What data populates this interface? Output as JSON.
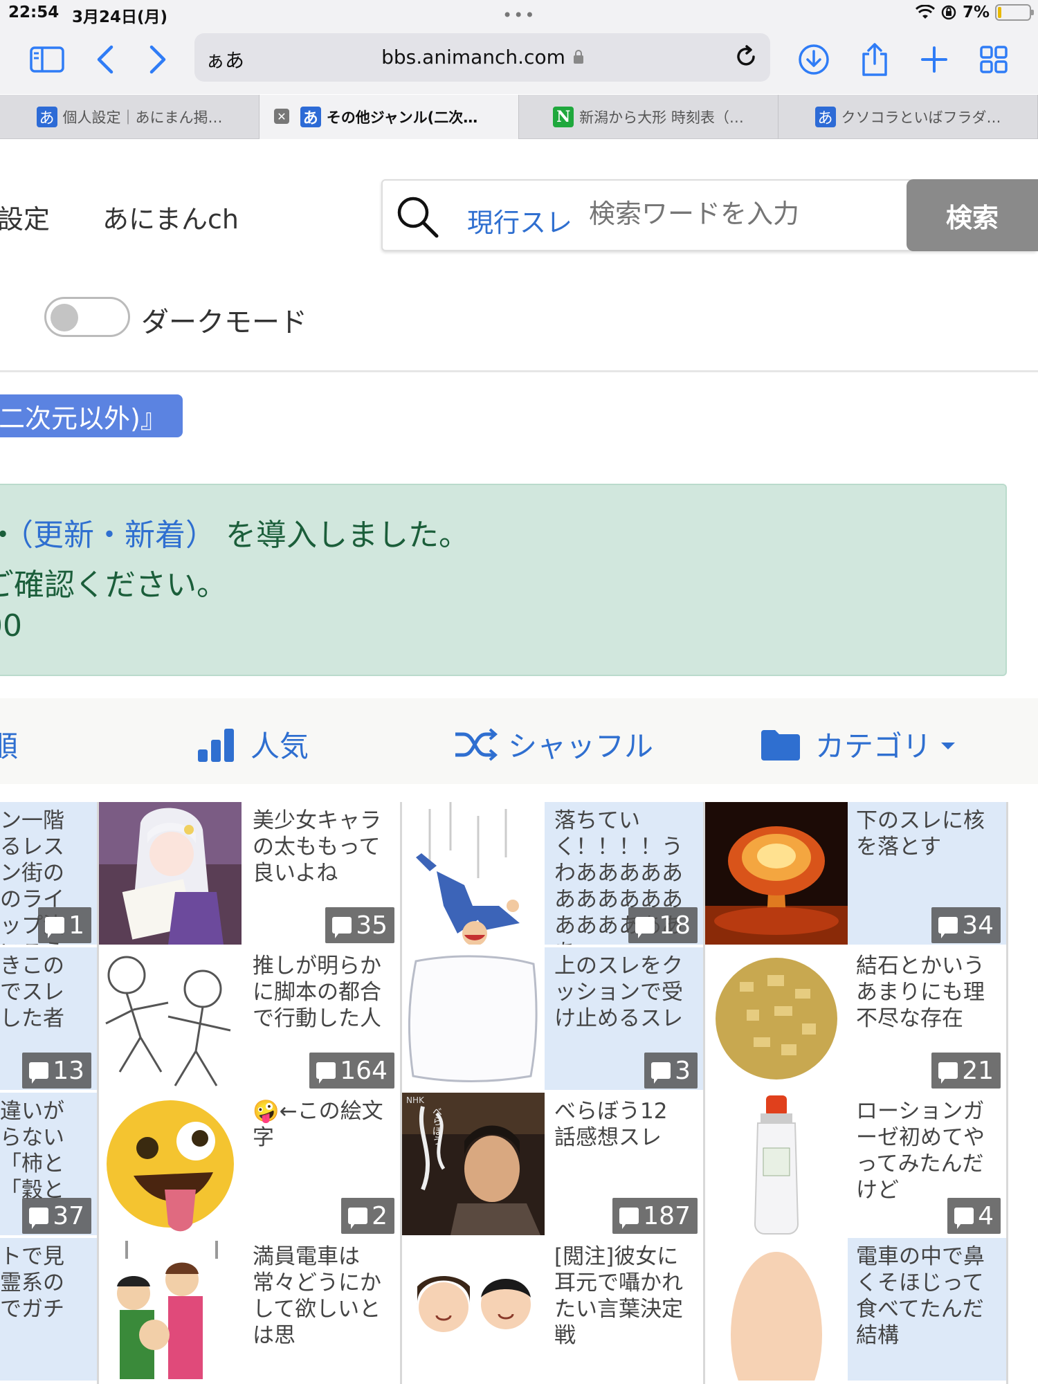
{
  "status": {
    "time": "22:54",
    "date": "3月24日(月)",
    "battery": "7%"
  },
  "browser": {
    "url_aa": "ぁあ",
    "url": "bbs.animanch.com",
    "tabs": [
      {
        "favicon": "あ",
        "title": "個人設定｜あにまん掲…"
      },
      {
        "favicon": "あ",
        "title": "その他ジャンル(二次…"
      },
      {
        "favicon": "N",
        "title": "新潟から大形 時刻表（…"
      },
      {
        "favicon": "あ",
        "title": "クソコラといばフラダ…"
      }
    ]
  },
  "header": {
    "settings_link": "設定",
    "site_link": "あにまんch",
    "search_scope": "現行スレ",
    "search_placeholder": "検索ワードを入力",
    "search_button": "検索",
    "dark_mode_label": "ダークモード"
  },
  "board": {
    "badge": "二次元以外)』"
  },
  "notice": {
    "line1_link": "（更新・新着）",
    "line1_text": "を導入しました。",
    "line1_prefix": "・",
    "line2": "ご確認ください。",
    "line3": "00"
  },
  "sort": {
    "partial": "順",
    "popular": "人気",
    "shuffle": "シャッフル",
    "category": "カテゴリ"
  },
  "threads": [
    {
      "title": "ン一階るレスン街ののライップ決いこう",
      "count": "1"
    },
    {
      "title": "美少女キャラの太ももって良いよね",
      "count": "35"
    },
    {
      "title": "落ちていく！！！！うわああああああああああああああああああ",
      "count": "18"
    },
    {
      "title": "下のスレに核を落とす",
      "count": "34"
    },
    {
      "title": "きこのでスレした者",
      "count": "13"
    },
    {
      "title": "推しが明らかに脚本の都合で行動した人",
      "count": "164"
    },
    {
      "title": "上のスレをクッションで受け止めるスレ",
      "count": "3"
    },
    {
      "title": "結石とかいうあまりにも理不尽な存在",
      "count": "21"
    },
    {
      "title": "違いがらない「柿と「穀と",
      "count": "37"
    },
    {
      "title": "🤪←この絵文字",
      "count": "2"
    },
    {
      "title": "べらぼう12話感想スレ",
      "count": "187"
    },
    {
      "title": "ローションガーゼ初めてやってみたんだけど",
      "count": "4"
    },
    {
      "title": "トで見霊系のでガチ",
      "count": ""
    },
    {
      "title": "満員電車は常々どうにかして欲しいとは思",
      "count": ""
    },
    {
      "title": "[閲注]彼女に耳元で囁かれたい言葉決定戦",
      "count": ""
    },
    {
      "title": "電車の中で鼻くそほじって食べてたんだ結構",
      "count": ""
    }
  ],
  "image_labels": {
    "nhk": "NHK",
    "berabou": "べらぼう"
  },
  "colors": {
    "accent": "#2f6fd0",
    "notice_bg": "#d1e7dd",
    "tinted_cell": "#dde9f8",
    "search_button": "#8a8a8a"
  }
}
